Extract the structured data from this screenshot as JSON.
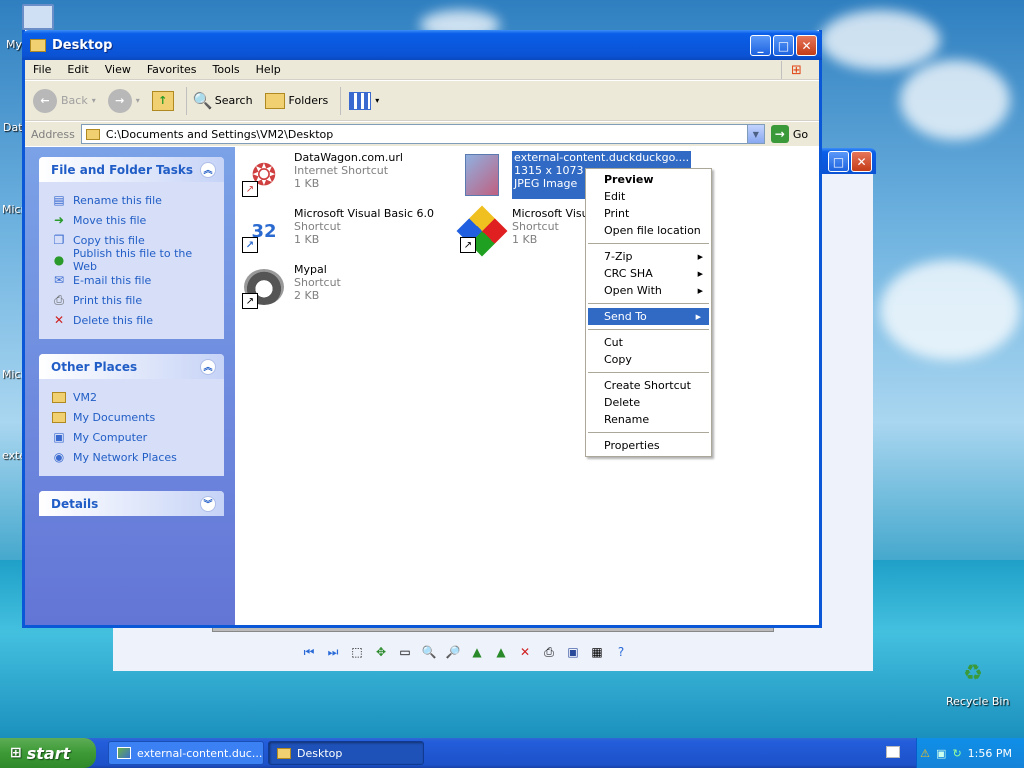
{
  "desktop": {
    "labels": [
      "My",
      "Dat",
      "Micro C",
      "Micro B",
      "exte"
    ],
    "recycle_bin": "Recycle Bin"
  },
  "window": {
    "title": "Desktop"
  },
  "menu": [
    "File",
    "Edit",
    "View",
    "Favorites",
    "Tools",
    "Help"
  ],
  "toolbar": {
    "back": "Back",
    "search": "Search",
    "folders": "Folders"
  },
  "address": {
    "label": "Address",
    "value": "C:\\Documents and Settings\\VM2\\Desktop",
    "go": "Go"
  },
  "file_tasks": {
    "title": "File and Folder Tasks",
    "items": [
      "Rename this file",
      "Move this file",
      "Copy this file",
      "Publish this file to the Web",
      "E-mail this file",
      "Print this file",
      "Delete this file"
    ]
  },
  "other_places": {
    "title": "Other Places",
    "items": [
      "VM2",
      "My Documents",
      "My Computer",
      "My Network Places"
    ]
  },
  "details": {
    "title": "Details"
  },
  "files": [
    {
      "name": "DataWagon.com.url",
      "type": "Internet Shortcut",
      "size": "1 KB"
    },
    {
      "name": "external-content.duckduckgo....",
      "type": "1315 x 1073",
      "size": "JPEG Image"
    },
    {
      "name": "Microsoft Visual Basic 6.0",
      "type": "Shortcut",
      "size": "1 KB"
    },
    {
      "name": "Microsoft Visual",
      "type": "Shortcut",
      "size": "1 KB"
    },
    {
      "name": "Mypal",
      "type": "Shortcut",
      "size": "2 KB"
    }
  ],
  "context_menu": {
    "preview": "Preview",
    "edit": "Edit",
    "print": "Print",
    "open_location": "Open file location",
    "zip": "7-Zip",
    "crc": "CRC SHA",
    "open_with": "Open With",
    "send_to": "Send To",
    "cut": "Cut",
    "copy": "Copy",
    "create_shortcut": "Create Shortcut",
    "delete": "Delete",
    "rename": "Rename",
    "properties": "Properties"
  },
  "taskbar": {
    "start": "start",
    "tasks": [
      "external-content.duc...",
      "Desktop"
    ],
    "clock": "1:56 PM"
  }
}
